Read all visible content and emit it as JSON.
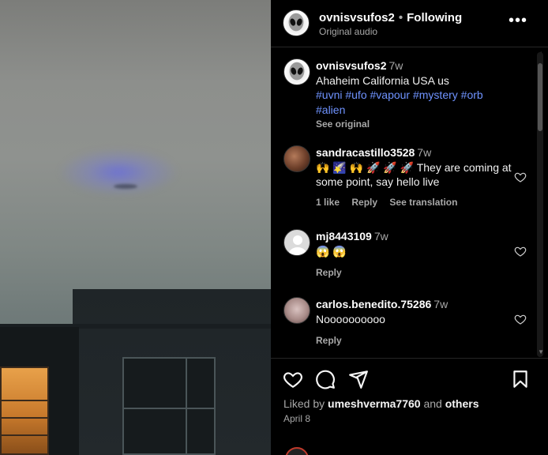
{
  "post": {
    "username": "ovnisvsufos2",
    "separator": "•",
    "follow_status": "Following",
    "audio": "Original audio",
    "more_icon": "more-horizontal-icon"
  },
  "caption": {
    "username": "ovnisvsufos2",
    "time": "7w",
    "text": "Ahaheim California USA us",
    "hashtags": [
      "#uvni",
      "#ufo",
      "#vapour",
      "#mystery",
      "#orb",
      "#alien"
    ],
    "see_original": "See original"
  },
  "comments": [
    {
      "username": "sandracastillo3528",
      "time": "7w",
      "emojis": [
        "🙌",
        "🌠",
        "🙌",
        "🚀",
        "🚀",
        "🚀"
      ],
      "text": "They are coming at some point, say hello live",
      "likes": "1 like",
      "reply": "Reply",
      "translate": "See translation"
    },
    {
      "username": "mj8443109",
      "time": "7w",
      "emojis": [
        "😱",
        "😱"
      ],
      "text": "",
      "reply": "Reply"
    },
    {
      "username": "carlos.benedito.75286",
      "time": "7w",
      "text": "Noooooooooo",
      "reply": "Reply"
    }
  ],
  "actions": {
    "icons": [
      "heart-icon",
      "comment-icon",
      "share-icon",
      "bookmark-icon"
    ],
    "liked_by_prefix": "Liked by",
    "liked_by_user": "umeshverma7760",
    "liked_by_and": "and",
    "liked_by_others": "others",
    "date": "April 8"
  },
  "colors": {
    "hashtag": "#6f93ff",
    "background": "#000000",
    "secondary_text": "#a8a8a8"
  }
}
